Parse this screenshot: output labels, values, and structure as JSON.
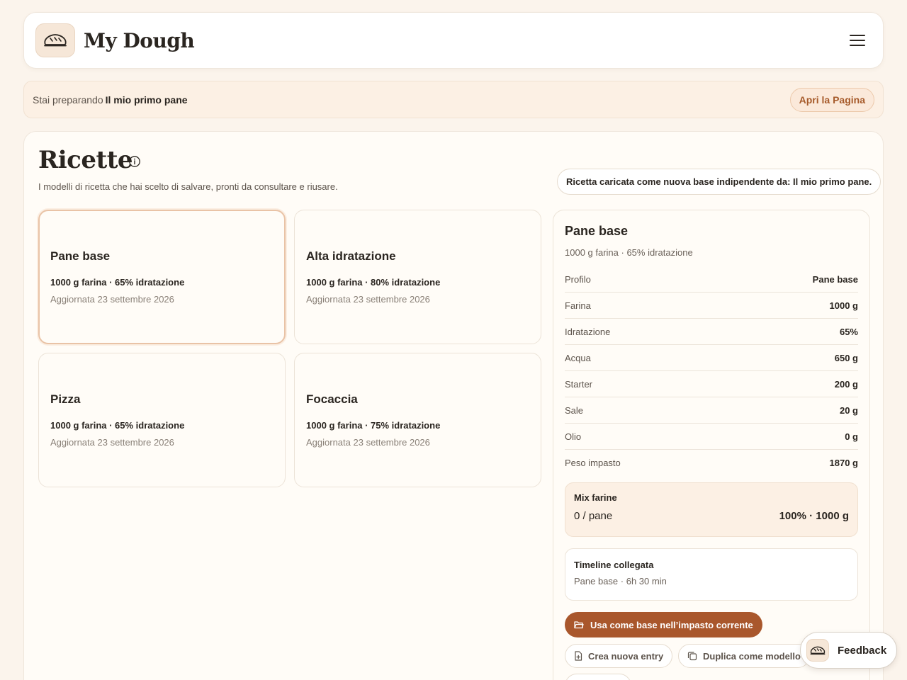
{
  "app": {
    "brand": "My Dough",
    "logo_icon": "bread-icon",
    "menu_icon": "hamburger-menu-icon"
  },
  "prep": {
    "prefix": "Stai preparando",
    "recipe": "Il mio primo pane",
    "open_label": "Apri la Pagina"
  },
  "page": {
    "title": "Ricette",
    "subtitle": "I modelli di ricetta che hai scelto di salvare, pronti da consultare e riusare.",
    "toast": "Ricetta caricata come nuova base indipendente da: Il mio primo pane."
  },
  "recipes": [
    {
      "title": "Pane base",
      "meta": "1000 g farina · 65% idratazione",
      "date": "Aggiornata 23 settembre 2026",
      "selected": true
    },
    {
      "title": "Alta idratazione",
      "meta": "1000 g farina · 80% idratazione",
      "date": "Aggiornata 23 settembre 2026"
    },
    {
      "title": "Pizza",
      "meta": "1000 g farina · 65% idratazione",
      "date": "Aggiornata 23 settembre 2026"
    },
    {
      "title": "Focaccia",
      "meta": "1000 g farina · 75% idratazione",
      "date": "Aggiornata 23 settembre 2026"
    }
  ],
  "detail": {
    "title": "Pane base",
    "subtitle": "1000 g farina · 65% idratazione",
    "rows": [
      {
        "k": "Profilo",
        "v": "Pane base"
      },
      {
        "k": "Farina",
        "v": "1000 g"
      },
      {
        "k": "Idratazione",
        "v": "65%"
      },
      {
        "k": "Acqua",
        "v": "650 g"
      },
      {
        "k": "Starter",
        "v": "200 g"
      },
      {
        "k": "Sale",
        "v": "20 g"
      },
      {
        "k": "Olio",
        "v": "0 g"
      },
      {
        "k": "Peso impasto",
        "v": "1870 g"
      }
    ],
    "mix": {
      "title": "Mix farine",
      "left": "0 / pane",
      "right": "100% · 1000 g"
    },
    "timeline": {
      "title": "Timeline collegata",
      "sub": "Pane base · 6h 30 min"
    },
    "primary_label": "Usa come base nell’impasto corrente",
    "create_label": "Crea nuova entry",
    "duplicate_label": "Duplica come modello"
  },
  "feedback": {
    "label": "Feedback"
  },
  "colors": {
    "accent": "#a9572c",
    "background": "#fbf4ec",
    "panel": "#fffcf7"
  }
}
